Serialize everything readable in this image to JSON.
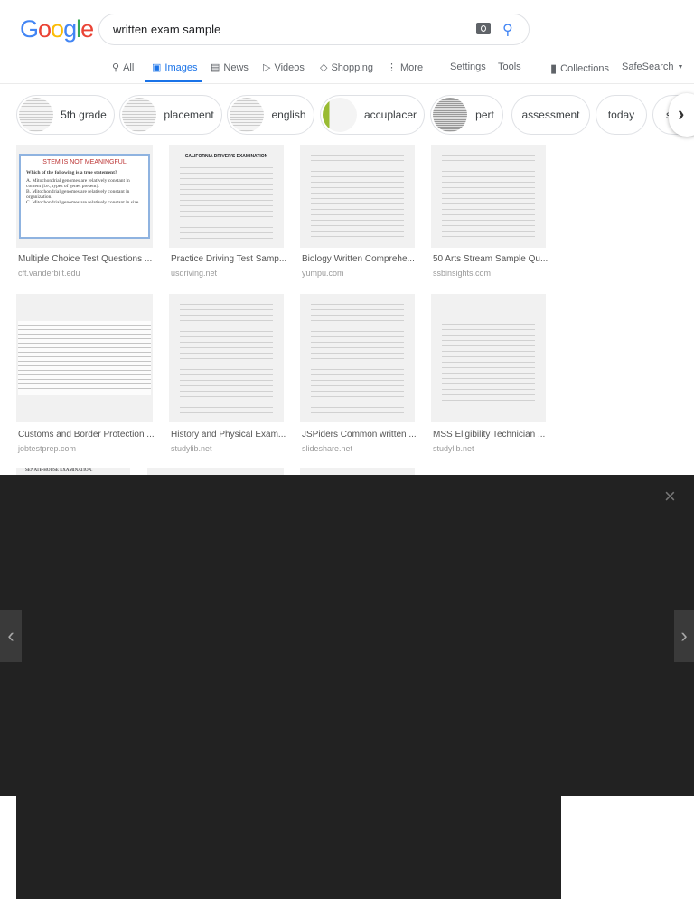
{
  "logo": {
    "letters": [
      "G",
      "o",
      "o",
      "g",
      "l",
      "e"
    ],
    "colors": [
      "#4285f4",
      "#ea4335",
      "#fbbc05",
      "#4285f4",
      "#34a853",
      "#ea4335"
    ]
  },
  "search": {
    "query": "written exam sample"
  },
  "nav": {
    "all": "All",
    "images": "Images",
    "news": "News",
    "videos": "Videos",
    "shopping": "Shopping",
    "more": "More",
    "settings": "Settings",
    "tools": "Tools",
    "collections": "Collections",
    "safesearch": "SafeSearch"
  },
  "chips": [
    "5th grade",
    "placement",
    "english",
    "accuplacer",
    "pert",
    "assessment",
    "today",
    "s"
  ],
  "results": [
    {
      "caption": "Multiple Choice Test Questions ...",
      "source": "cft.vanderbilt.edu"
    },
    {
      "caption": "Practice Driving Test Samp...",
      "source": "usdriving.net"
    },
    {
      "caption": "Biology Written Comprehe...",
      "source": "yumpu.com"
    },
    {
      "caption": "50 Arts Stream Sample Qu...",
      "source": "ssbinsights.com"
    },
    {
      "caption": "Customs and Border Protection ...",
      "source": "jobtestprep.com"
    },
    {
      "caption": "History and Physical Exam...",
      "source": "studylib.net"
    },
    {
      "caption": "JSPiders Common written ...",
      "source": "slideshare.net"
    },
    {
      "caption": "MSS Eligibility Technician ...",
      "source": "studylib.net"
    }
  ],
  "thumb1": {
    "title": "STEM IS NOT MEANINGFUL",
    "question": "Which of the following is a true statement?",
    "a": "A. Mitochondrial genomes are relatively constant in content (i.e., types of genes present).",
    "b": "B. Mitochondrial genomes are relatively constant in organization.",
    "c": "C. Mitochondrial genomes are relatively constant in size."
  },
  "thumb2": {
    "title": "CALIFORNIA DRIVER'S EXAMINATION"
  },
  "thumb9": {
    "title": "SENATE-HOUSE EXAMINATION."
  },
  "viewer": {
    "close": "×",
    "prev": "‹",
    "next": "›"
  }
}
